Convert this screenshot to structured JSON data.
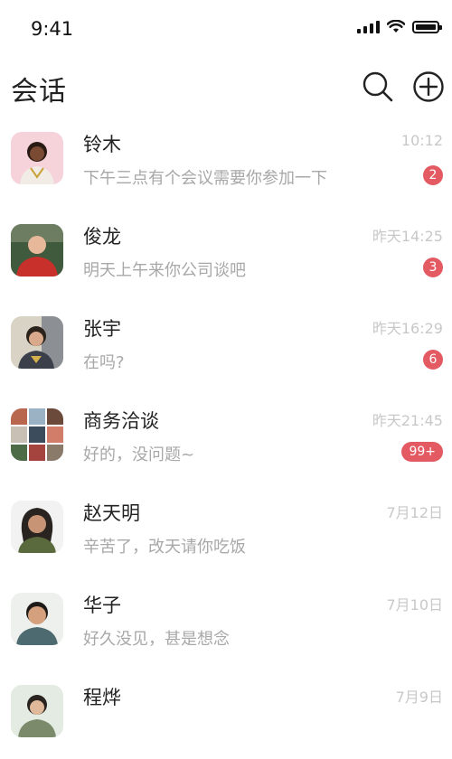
{
  "status_bar": {
    "time": "9:41"
  },
  "header": {
    "title": "会话",
    "search_icon": "search-icon",
    "add_icon": "plus-circle-icon"
  },
  "conversations": [
    {
      "name": "铃木",
      "time": "10:12",
      "message": "下午三点有个会议需要你参加一下",
      "badge": "2"
    },
    {
      "name": "俊龙",
      "time": "昨天14:25",
      "message": "明天上午来你公司谈吧",
      "badge": "3"
    },
    {
      "name": "张宇",
      "time": "昨天16:29",
      "message": "在吗?",
      "badge": "6"
    },
    {
      "name": "商务洽谈",
      "time": "昨天21:45",
      "message": "好的，没问题~",
      "badge": "99+"
    },
    {
      "name": "赵天明",
      "time": "7月12日",
      "message": "辛苦了，改天请你吃饭"
    },
    {
      "name": "华子",
      "time": "7月10日",
      "message": "好久没见，甚是想念"
    },
    {
      "name": "程烨",
      "time": "7月9日"
    }
  ],
  "colors": {
    "badge": "#e35a63",
    "muted_text": "#a8a8a8",
    "time_text": "#c8c8c8"
  }
}
